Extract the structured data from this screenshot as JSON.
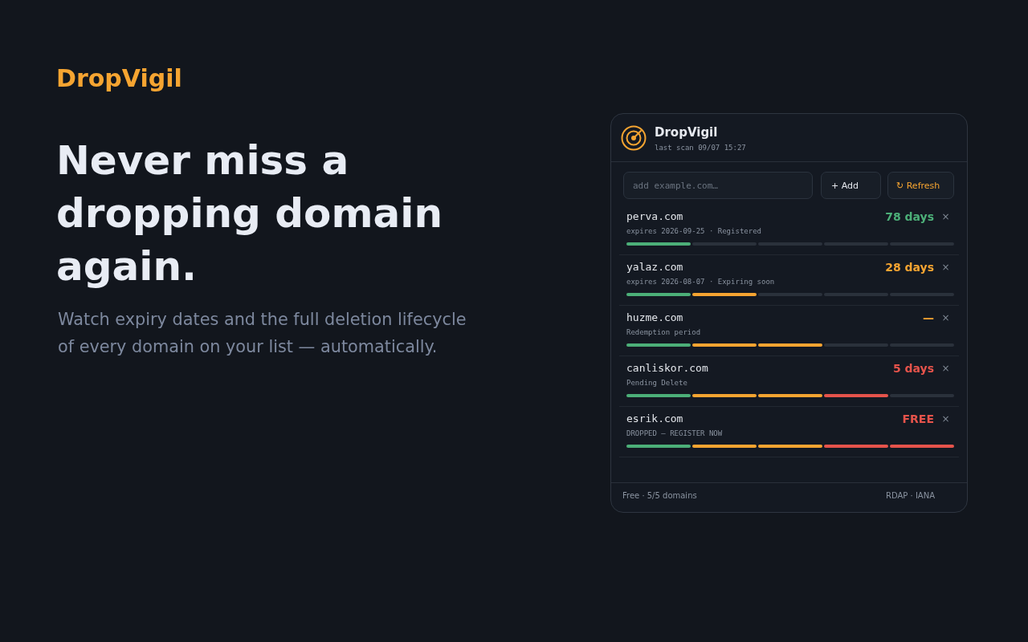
{
  "brand": "DropVigil",
  "hero": {
    "title": "Never miss a dropping domain again.",
    "subtitle": "Watch expiry dates and the full deletion lifecycle of every domain on your list — automatically."
  },
  "panel": {
    "title": "DropVigil",
    "last_scan": "last scan 09/07 15:27",
    "add_field": {
      "placeholder": "add example.com…"
    },
    "buttons": [
      {
        "label": "+ Add",
        "kind": "add"
      },
      {
        "label": "↻ Refresh",
        "kind": "refresh"
      }
    ],
    "domains": [
      {
        "name": "perva.com",
        "status": "expires 2026-09-25 · Registered",
        "remaining": "78 days",
        "color": "#4caf78",
        "remove": "×",
        "stages": [
          {
            "reached": true
          },
          {
            "reached": false
          },
          {
            "reached": false
          },
          {
            "reached": false
          },
          {
            "reached": false
          }
        ]
      },
      {
        "name": "yalaz.com",
        "status": "expires 2026-08-07 · Expiring soon",
        "remaining": "28 days",
        "color": "#f5a431",
        "remove": "×",
        "stages": [
          {
            "reached": true
          },
          {
            "reached": true
          },
          {
            "reached": false
          },
          {
            "reached": false
          },
          {
            "reached": false
          }
        ]
      },
      {
        "name": "huzme.com",
        "status": "Redemption period",
        "remaining": "—",
        "color": "#f5a431",
        "remove": "×",
        "stages": [
          {
            "reached": true
          },
          {
            "reached": true
          },
          {
            "reached": true
          },
          {
            "reached": false
          },
          {
            "reached": false
          }
        ]
      },
      {
        "name": "canliskor.com",
        "status": "Pending Delete",
        "remaining": "5 days",
        "color": "#e5534b",
        "remove": "×",
        "stages": [
          {
            "reached": true
          },
          {
            "reached": true
          },
          {
            "reached": true
          },
          {
            "reached": true
          },
          {
            "reached": false
          }
        ]
      },
      {
        "name": "esrik.com",
        "status": "DROPPED — REGISTER NOW",
        "remaining": "FREE",
        "color": "#e5534b",
        "remove": "×",
        "stages": [
          {
            "reached": true
          },
          {
            "reached": true
          },
          {
            "reached": true
          },
          {
            "reached": true
          },
          {
            "reached": true
          }
        ]
      }
    ],
    "footer": {
      "plan": "Free · 5/5 domains",
      "sources": "RDAP · IANA"
    }
  }
}
